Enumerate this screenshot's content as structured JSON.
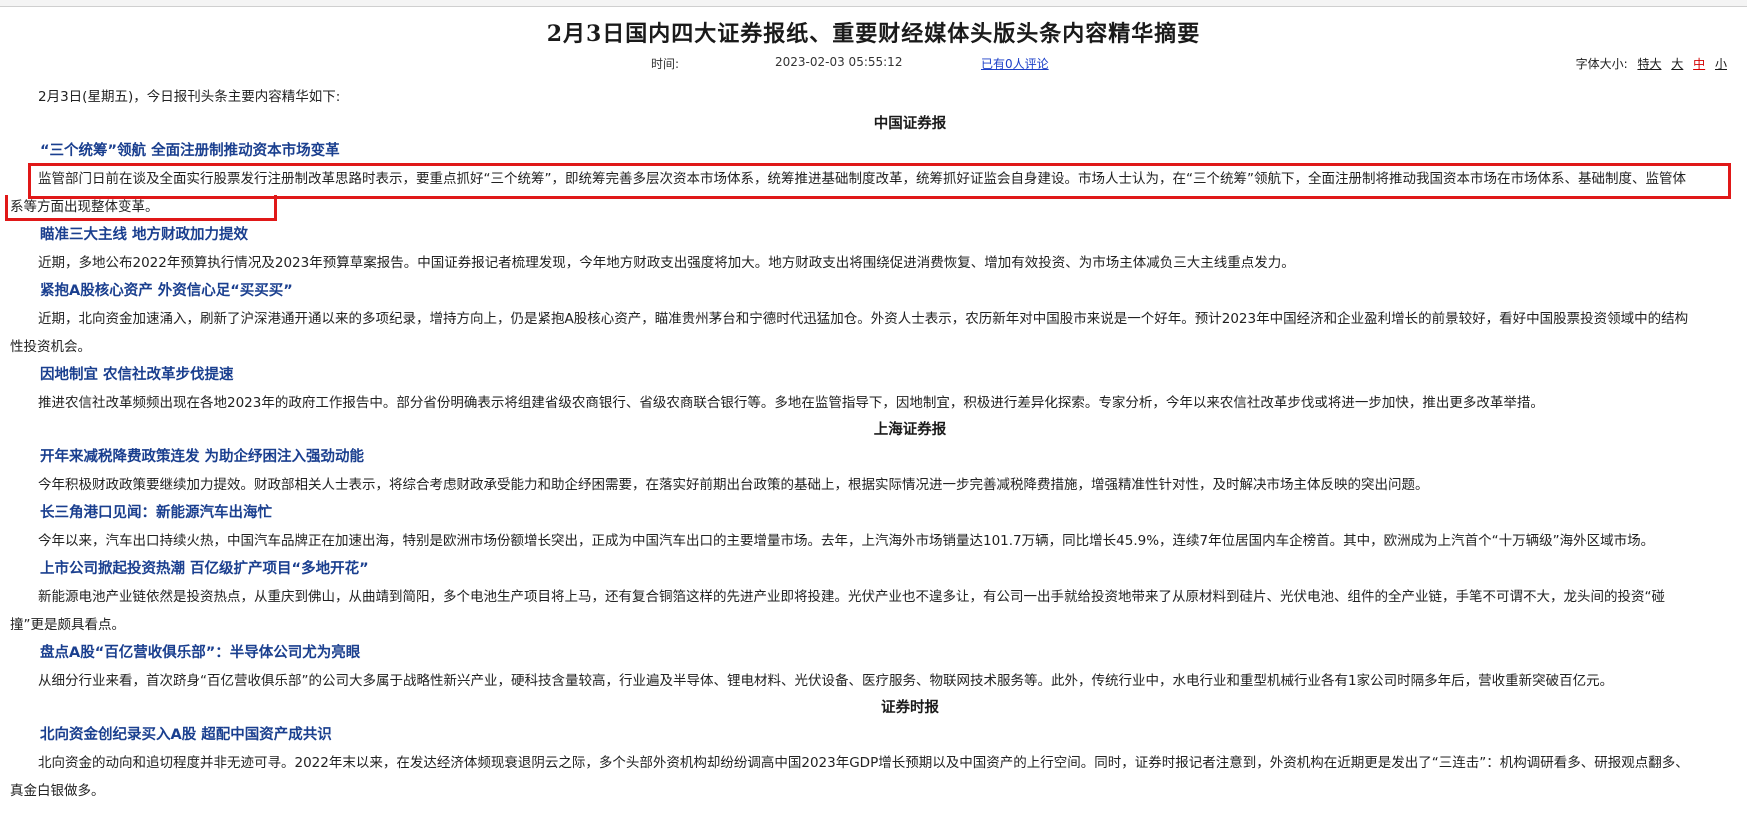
{
  "page": {
    "title": "2月3日国内四大证券报纸、重要财经媒体头版头条内容精华摘要",
    "time_label": "时间:",
    "time_value": "2023-02-03 05:55:12",
    "comments_link": "已有0人评论"
  },
  "font_size_control": {
    "label": "字体大小:",
    "options": [
      "特大",
      "大",
      "中",
      "小"
    ],
    "selected": "中"
  },
  "intro": "2月3日(星期五)，今日报刊头条主要内容精华如下:",
  "sections": [
    {
      "name": "中国证券报",
      "articles": [
        {
          "title": "“三个统筹”领航 全面注册制推动资本市场变革",
          "body": "监管部门日前在谈及全面实行股票发行注册制改革思路时表示，要重点抓好“三个统筹”，即统筹完善多层次资本市场体系，统筹推进基础制度改革，统筹抓好证监会自身建设。市场人士认为，在“三个统筹”领航下，全面注册制将推动我国资本市场在市场体系、基础制度、监管体系等方面出现整体变革。"
        },
        {
          "title": "瞄准三大主线 地方财政加力提效",
          "body": "近期，多地公布2022年预算执行情况及2023年预算草案报告。中国证券报记者梳理发现，今年地方财政支出强度将加大。地方财政支出将围绕促进消费恢复、增加有效投资、为市场主体减负三大主线重点发力。"
        },
        {
          "title": "紧抱A股核心资产 外资信心足“买买买”",
          "body": "近期，北向资金加速涌入，刷新了沪深港通开通以来的多项纪录，增持方向上，仍是紧抱A股核心资产，瞄准贵州茅台和宁德时代迅猛加仓。外资人士表示，农历新年对中国股市来说是一个好年。预计2023年中国经济和企业盈利增长的前景较好，看好中国股票投资领域中的结构性投资机会。"
        },
        {
          "title": "因地制宜 农信社改革步伐提速",
          "body": "推进农信社改革频频出现在各地2023年的政府工作报告中。部分省份明确表示将组建省级农商银行、省级农商联合银行等。多地在监管指导下，因地制宜，积极进行差异化探索。专家分析，今年以来农信社改革步伐或将进一步加快，推出更多改革举措。"
        }
      ]
    },
    {
      "name": "上海证券报",
      "articles": [
        {
          "title": "开年来减税降费政策连发 为助企纾困注入强劲动能",
          "body": "今年积极财政政策要继续加力提效。财政部相关人士表示，将综合考虑财政承受能力和助企纾困需要，在落实好前期出台政策的基础上，根据实际情况进一步完善减税降费措施，增强精准性针对性，及时解决市场主体反映的突出问题。"
        },
        {
          "title": "长三角港口见闻：新能源汽车出海忙",
          "body": "今年以来，汽车出口持续火热，中国汽车品牌正在加速出海，特别是欧洲市场份额增长突出，正成为中国汽车出口的主要增量市场。去年，上汽海外市场销量达101.7万辆，同比增长45.9%，连续7年位居国内车企榜首。其中，欧洲成为上汽首个“十万辆级”海外区域市场。"
        },
        {
          "title": "上市公司掀起投资热潮 百亿级扩产项目“多地开花”",
          "body": "新能源电池产业链依然是投资热点，从重庆到佛山，从曲靖到简阳，多个电池生产项目将上马，还有复合铜箔这样的先进产业即将投建。光伏产业也不遑多让，有公司一出手就给投资地带来了从原材料到硅片、光伏电池、组件的全产业链，手笔不可谓不大，龙头间的投资“碰撞”更是颇具看点。"
        },
        {
          "title": "盘点A股“百亿营收俱乐部”：半导体公司尤为亮眼",
          "body": "从细分行业来看，首次跻身“百亿营收俱乐部”的公司大多属于战略性新兴产业，硬科技含量较高，行业遍及半导体、锂电材料、光伏设备、医疗服务、物联网技术服务等。此外，传统行业中，水电行业和重型机械行业各有1家公司时隔多年后，营收重新突破百亿元。"
        }
      ]
    },
    {
      "name": "证券时报",
      "articles": [
        {
          "title": "北向资金创纪录买入A股 超配中国资产成共识",
          "body": "北向资金的动向和追切程度并非无迹可寻。2022年末以来，在发达经济体频现衰退阴云之际，多个头部外资机构却纷纷调高中国2023年GDP增长预期以及中国资产的上行空间。同时，证券时报记者注意到，外资机构在近期更是发出了“三连击”：机构调研看多、研报观点翻多、真金白银做多。"
        }
      ]
    }
  ],
  "colors": {
    "article_title": "#1a3f8f",
    "link": "#1b3fc8",
    "highlight_box": "#e01818",
    "selected_font_size": "#d40000"
  }
}
